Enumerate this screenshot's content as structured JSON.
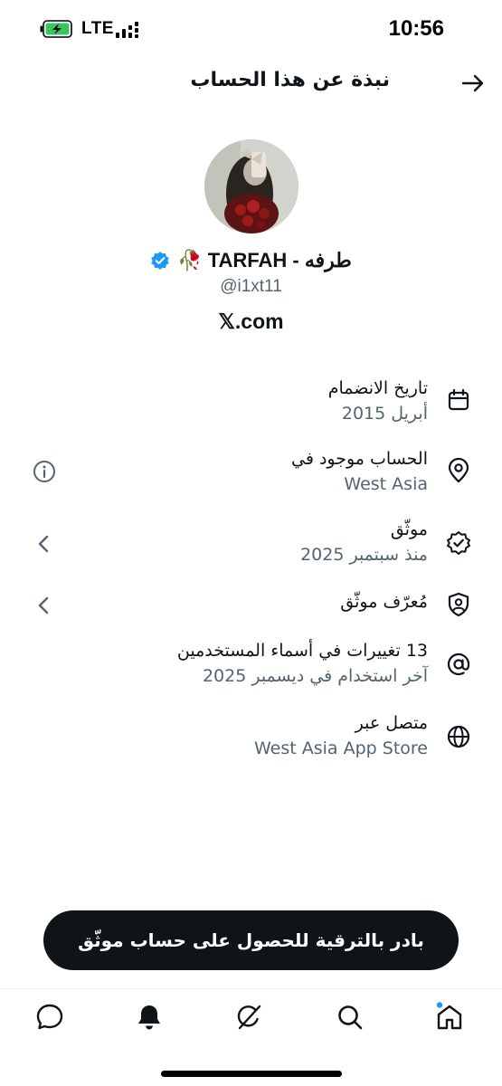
{
  "status_bar": {
    "time": "10:56",
    "network": "LTE"
  },
  "header": {
    "title": "نبذة عن هذا الحساب",
    "back_icon": "arrow-right-icon"
  },
  "profile": {
    "display_name": "طرفه - TARFAH 🥀",
    "verified_badge": "blue-check",
    "handle": "@i1xt11",
    "link": "𝕏.com"
  },
  "rows": {
    "joined": {
      "icon": "calendar-icon",
      "title": "تاريخ الانضمام",
      "subtitle": "أبريل 2015"
    },
    "location": {
      "icon": "location-pin-icon",
      "title": "الحساب موجود في",
      "subtitle": "West Asia",
      "action_icon": "info-icon"
    },
    "verified": {
      "icon": "verified-badge-icon",
      "title": "موثّق",
      "subtitle": "منذ سبتمبر 2025",
      "action_icon": "chevron-left-icon"
    },
    "id_verified": {
      "icon": "id-shield-icon",
      "title": "مُعرّف موثّق",
      "action_icon": "chevron-left-icon"
    },
    "username_changes": {
      "icon": "at-sign-icon",
      "title": "13 تغييرات في أسماء المستخدمين",
      "subtitle": "آخر استخدام في ديسمبر 2025"
    },
    "connected_via": {
      "icon": "globe-icon",
      "title": "متصل عبر",
      "subtitle": "West Asia App Store"
    }
  },
  "upgrade_button": {
    "label": "بادر بالترقية للحصول على حساب موثّق"
  },
  "bottom_nav": [
    "messages-icon",
    "notifications-icon",
    "grok-icon",
    "search-icon",
    "home-icon"
  ],
  "colors": {
    "text_primary": "#0f1419",
    "text_secondary": "#536471",
    "verified_blue": "#1d9bf0",
    "battery_green": "#34c759"
  }
}
